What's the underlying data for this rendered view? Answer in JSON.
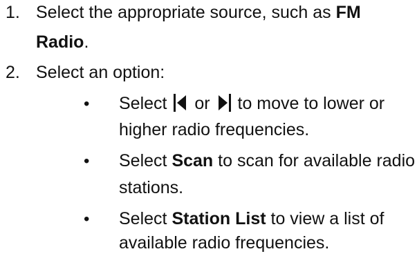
{
  "steps": [
    {
      "number": "1.",
      "text_a": "Select the appropriate source, such as ",
      "bold_a": "FM",
      "bold_b": "Radio",
      "text_b": "."
    },
    {
      "number": "2.",
      "text": "Select an option:"
    }
  ],
  "options": [
    {
      "pre": "Select ",
      "mid": " or ",
      "post": " to move to lower or",
      "cont": "higher radio frequencies.",
      "icons": [
        "previous-station-icon",
        "next-station-icon"
      ]
    },
    {
      "pre": "Select ",
      "bold": "Scan",
      "post": " to scan for available radio",
      "cont": "stations."
    },
    {
      "pre": "Select ",
      "bold": "Station List",
      "post": " to view a list of",
      "cont": "available radio frequencies."
    }
  ],
  "bullet_char": "•",
  "colors": {
    "text": "#111111",
    "background": "#ffffff"
  }
}
